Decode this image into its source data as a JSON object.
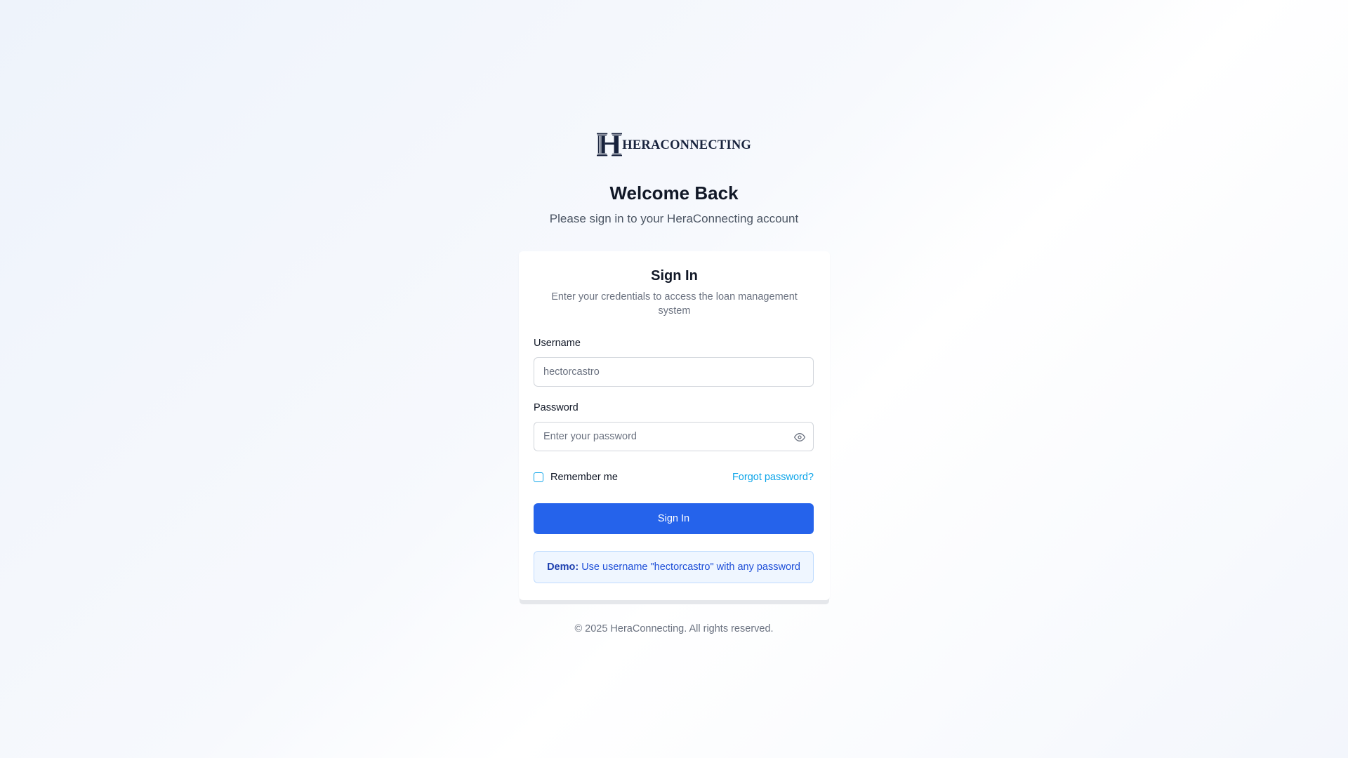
{
  "brand": {
    "logo_text": "HERACONNECTING",
    "logo_icon": "pillar-h-logo-icon"
  },
  "header": {
    "title": "Welcome Back",
    "subtitle": "Please sign in to your HeraConnecting account"
  },
  "card": {
    "title": "Sign In",
    "description": "Enter your credentials to access the loan management system",
    "username": {
      "label": "Username",
      "value": "",
      "placeholder": "hectorcastro"
    },
    "password": {
      "label": "Password",
      "value": "",
      "placeholder": "Enter your password",
      "toggle_icon": "eye-icon"
    },
    "remember": {
      "label": "Remember me",
      "checked": false
    },
    "forgot_link": "Forgot password?",
    "submit_label": "Sign In",
    "demo": {
      "prefix": "Demo:",
      "text": "Use username \"hectorcastro\" with any password"
    }
  },
  "footer": {
    "copyright": "© 2025 HeraConnecting. All rights reserved."
  },
  "colors": {
    "primary": "#2563eb",
    "link": "#0ea5e9",
    "brand_navy": "#18233d",
    "demo_bg": "#eff6ff"
  }
}
